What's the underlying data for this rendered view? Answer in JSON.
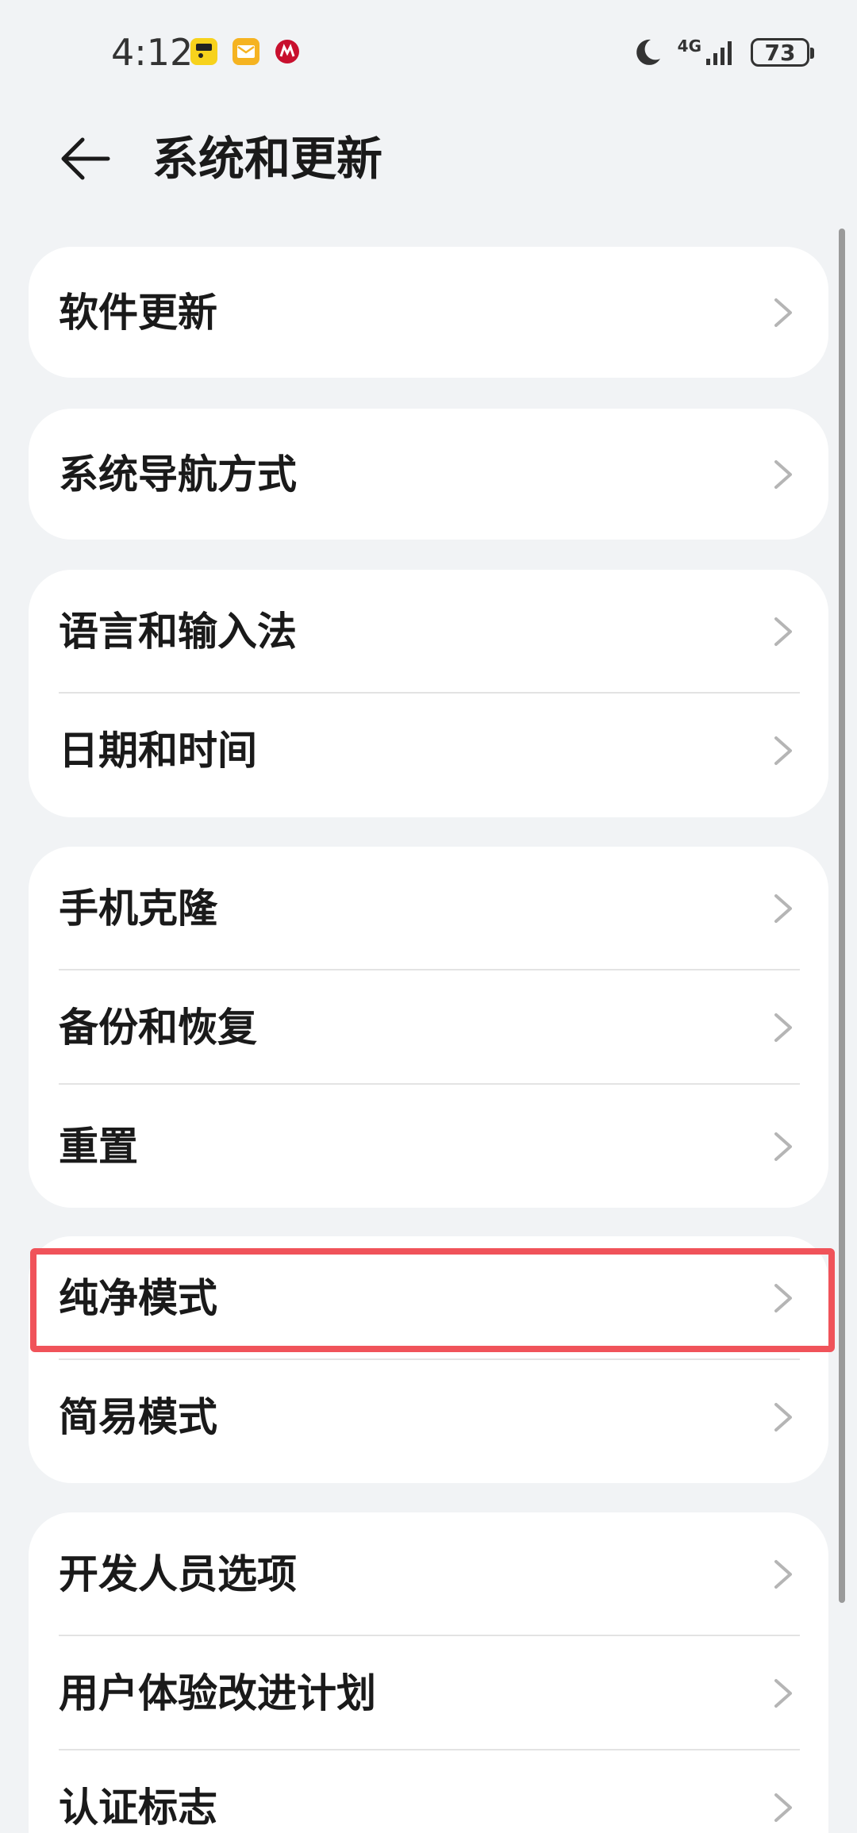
{
  "status_bar": {
    "time": "4:12",
    "network": "4G",
    "battery": "73",
    "icons": [
      "app-icon-yellow",
      "mail-icon",
      "bank-icon",
      "moon-icon",
      "signal-icon"
    ]
  },
  "header": {
    "title": "系统和更新"
  },
  "groups": [
    {
      "items": [
        {
          "label": "软件更新"
        }
      ]
    },
    {
      "items": [
        {
          "label": "系统导航方式"
        }
      ]
    },
    {
      "items": [
        {
          "label": "语言和输入法"
        },
        {
          "label": "日期和时间"
        }
      ]
    },
    {
      "items": [
        {
          "label": "手机克隆"
        },
        {
          "label": "备份和恢复"
        },
        {
          "label": "重置"
        }
      ]
    },
    {
      "items": [
        {
          "label": "纯净模式"
        },
        {
          "label": "简易模式"
        }
      ]
    },
    {
      "items": [
        {
          "label": "开发人员选项"
        },
        {
          "label": "用户体验改进计划"
        },
        {
          "label": "认证标志"
        }
      ]
    }
  ],
  "colors": {
    "background": "#f1f3f5",
    "card": "#ffffff",
    "highlight": "#f0535a"
  }
}
